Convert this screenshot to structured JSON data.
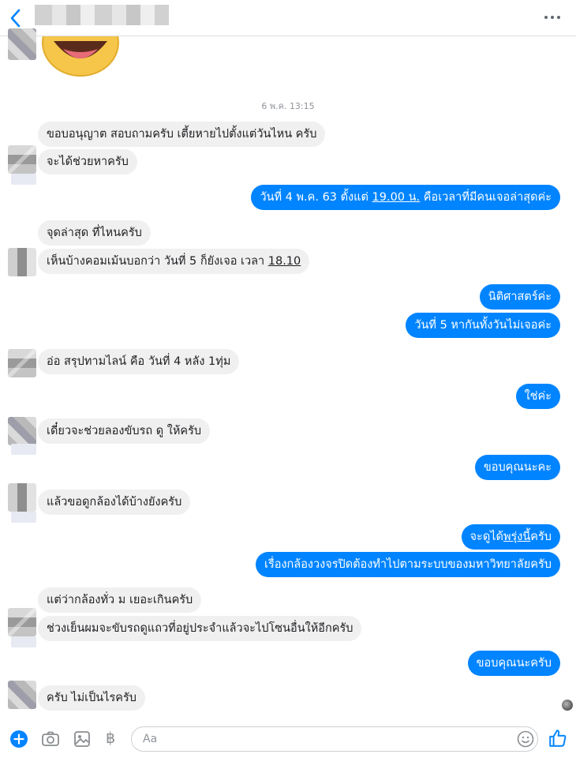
{
  "header": {
    "back_icon": "chevron-left-icon",
    "more_icon": "more-horizontal-icon"
  },
  "timestamp": "6 พ.ค. 13:15",
  "messages": [
    {
      "side": "in",
      "text": "ขอบอนุญาต สอบถามครับ เตี้ยหายไปตั้งแต่วันไหน ครับ"
    },
    {
      "side": "in",
      "text": "จะได้ช่วยหาครับ"
    },
    {
      "side": "out",
      "text_a": "วันที่ 4 พ.ค. 63 ตั้งแต่ ",
      "text_u": "19.00 น.",
      "text_b": " คือเวลาที่มีคนเจอล่าสุดค่ะ"
    },
    {
      "side": "in",
      "text": "จุดล่าสุด ที่ไหนครับ"
    },
    {
      "side": "in",
      "text_a": "เห็นบ้างคอมเม้นบอกว่า วันที่ 5 ก็ยังเจอ เวลา ",
      "text_u": "18.10"
    },
    {
      "side": "out",
      "text": "นิติศาสตร์ค่ะ"
    },
    {
      "side": "out",
      "text": "วันที่ 5 หากันทั้งวันไม่เจอค่ะ"
    },
    {
      "side": "in",
      "text": "อ่อ สรุปทามไลน์ คือ วันที่ 4 หลัง 1ทุ่ม"
    },
    {
      "side": "out",
      "text": "ใช่ค่ะ"
    },
    {
      "side": "in",
      "text": "เดี๋ยวจะช่วยลองขับรถ ดู ให้ครับ"
    },
    {
      "side": "out",
      "text": "ขอบคุณนะคะ"
    },
    {
      "side": "in",
      "text": "แล้วขอดูกล้องได้บ้างยังครับ"
    },
    {
      "side": "out",
      "text_a": "จะดูได้",
      "text_u": "พรุ่งนี้",
      "text_b": "ครับ"
    },
    {
      "side": "out",
      "text": "เรื่องกล้องวงจรปิดต้องทำไปตามระบบของมหาวิทยาลัยครับ"
    },
    {
      "side": "in",
      "text": "แต่ว่ากล้องทั่ว ม เยอะเกินครับ"
    },
    {
      "side": "in",
      "text": "ช่วงเย็นผมจะขับรถดูแถวที่อยู่ประจำแล้วจะไปโซนอื่นให้อีกครับ"
    },
    {
      "side": "out",
      "text": "ขอบคุณนะครับ"
    },
    {
      "side": "in",
      "text": "ครับ  ไม่เป็นไรครับ"
    }
  ],
  "composer": {
    "placeholder": "Aa",
    "baht_symbol": "฿",
    "icons": [
      "plus-icon",
      "camera-icon",
      "image-icon",
      "baht-icon",
      "emoji-icon",
      "like-icon"
    ]
  },
  "colors": {
    "outgoing_bubble": "#0084ff",
    "incoming_bubble": "#f1f0f0",
    "accent": "#0084ff"
  }
}
